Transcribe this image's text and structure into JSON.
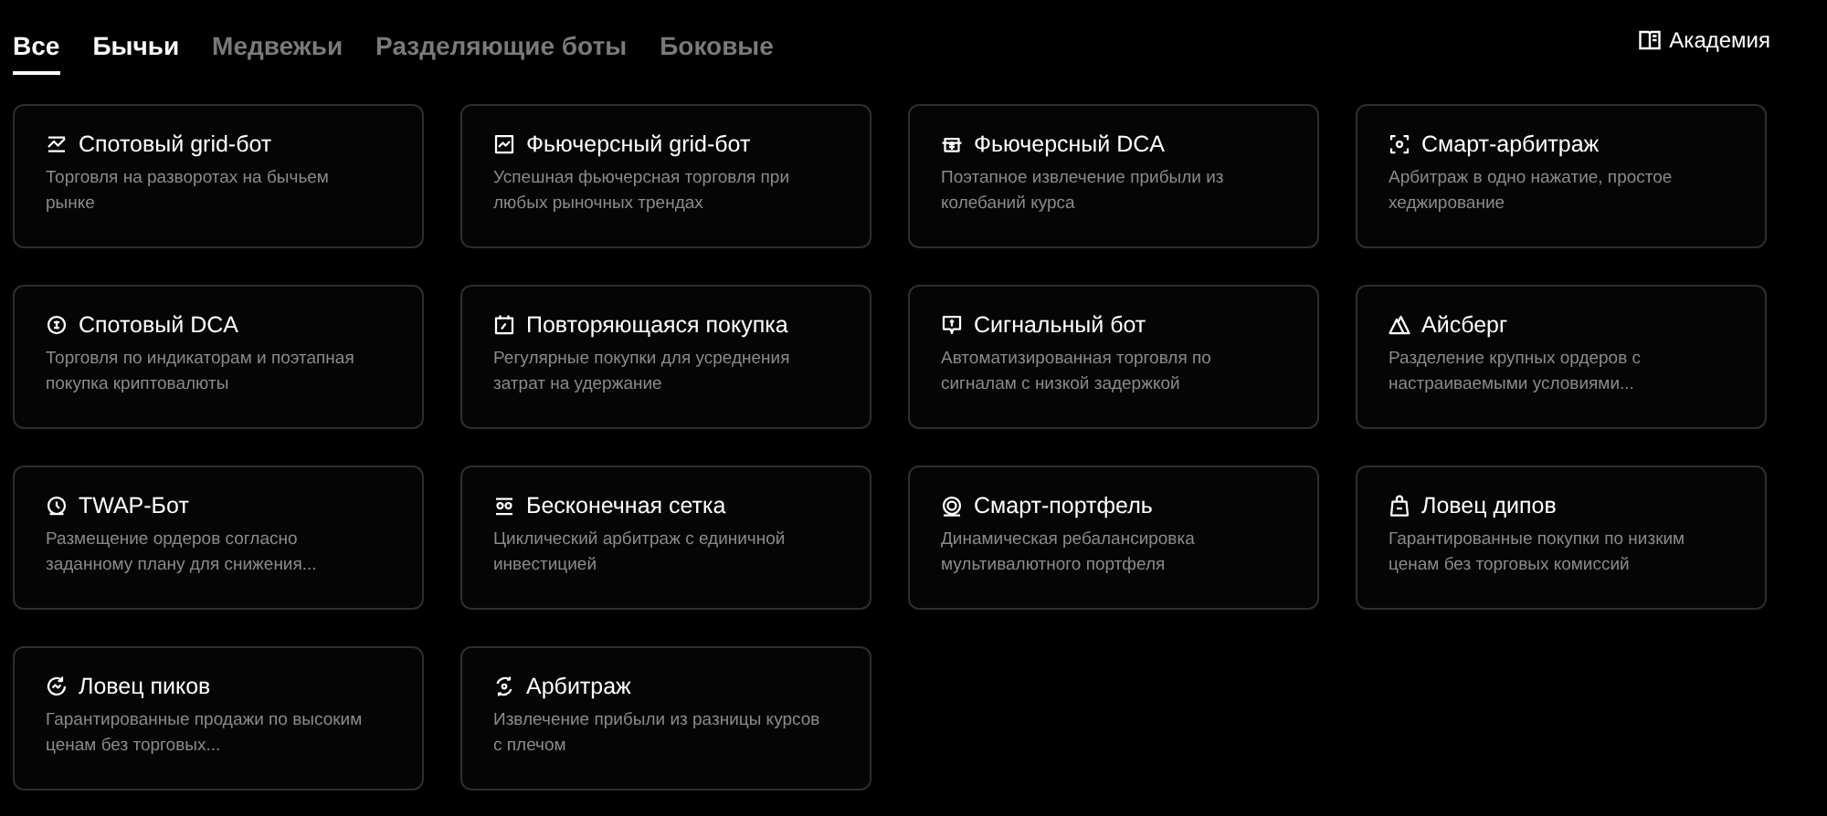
{
  "tabs": [
    {
      "label": "Все",
      "selected": true,
      "highlighted": true
    },
    {
      "label": "Бычьи",
      "selected": false,
      "highlighted": true
    },
    {
      "label": "Медвежьи",
      "selected": false,
      "highlighted": false
    },
    {
      "label": "Разделяющие боты",
      "selected": false,
      "highlighted": false
    },
    {
      "label": "Боковые",
      "selected": false,
      "highlighted": false
    }
  ],
  "academy_link": {
    "label": "Академия"
  },
  "bots": [
    {
      "title": "Спотовый grid-бот",
      "description": "Торговля на разворотах на бычьем рынке"
    },
    {
      "title": "Фьючерсный grid-бот",
      "description": "Успешная фьючерсная торговля при любых рыночных трендах"
    },
    {
      "title": "Фьючерсный DCA",
      "description": "Поэтапное извлечение прибыли из колебаний курса"
    },
    {
      "title": "Смарт-арбитраж",
      "description": "Арбитраж в одно нажатие, простое хеджирование"
    },
    {
      "title": "Спотовый DCA",
      "description": "Торговля по индикаторам и поэтапная покупка криптовалюты"
    },
    {
      "title": "Повторяющаяся покупка",
      "description": "Регулярные покупки для усреднения затрат на удержание"
    },
    {
      "title": "Сигнальный бот",
      "description": "Автоматизированная торговля по сигналам с низкой задержкой"
    },
    {
      "title": "Айсберг",
      "description": "Разделение крупных ордеров с настраиваемыми условиями..."
    },
    {
      "title": "TWAP-Бот",
      "description": "Размещение ордеров согласно заданному плану для снижения..."
    },
    {
      "title": "Бесконечная сетка",
      "description": "Циклический арбитраж с единичной инвестицией"
    },
    {
      "title": "Смарт-портфель",
      "description": "Динамическая ребалансировка мультивалютного портфеля"
    },
    {
      "title": "Ловец дипов",
      "description": "Гарантированные покупки по низким ценам без торговых комиссий"
    },
    {
      "title": "Ловец пиков",
      "description": "Гарантированные продажи по высоким ценам без торговых..."
    },
    {
      "title": "Арбитраж",
      "description": "Извлечение прибыли из разницы курсов с плечом"
    }
  ]
}
